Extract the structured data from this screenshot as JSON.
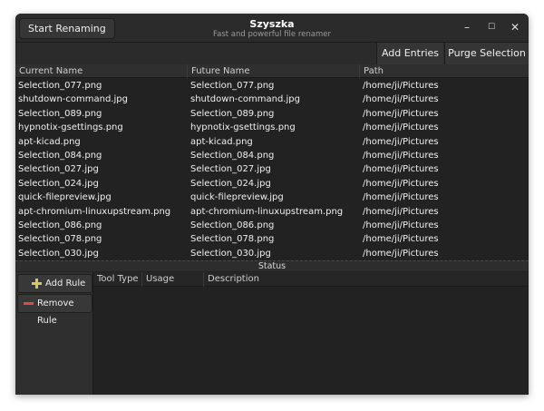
{
  "window": {
    "title": "Szyszka",
    "subtitle": "Fast and powerful file renamer",
    "start_button": "Start Renaming",
    "minimize_glyph": "–",
    "maximize_glyph": "☐",
    "close_glyph": "✕"
  },
  "toolbar": {
    "add_entries": "Add Entries",
    "purge_selection": "Purge Selection"
  },
  "table": {
    "columns": [
      "Current Name",
      "Future Name",
      "Path"
    ],
    "rows": [
      [
        "Selection_077.png",
        "Selection_077.png",
        "/home/ji/Pictures"
      ],
      [
        "shutdown-command.jpg",
        "shutdown-command.jpg",
        "/home/ji/Pictures"
      ],
      [
        "Selection_089.png",
        "Selection_089.png",
        "/home/ji/Pictures"
      ],
      [
        "hypnotix-gsettings.png",
        "hypnotix-gsettings.png",
        "/home/ji/Pictures"
      ],
      [
        "apt-kicad.png",
        "apt-kicad.png",
        "/home/ji/Pictures"
      ],
      [
        "Selection_084.png",
        "Selection_084.png",
        "/home/ji/Pictures"
      ],
      [
        "Selection_027.jpg",
        "Selection_027.jpg",
        "/home/ji/Pictures"
      ],
      [
        "Selection_024.jpg",
        "Selection_024.jpg",
        "/home/ji/Pictures"
      ],
      [
        "quick-filepreview.jpg",
        "quick-filepreview.jpg",
        "/home/ji/Pictures"
      ],
      [
        "apt-chromium-linuxupstream.png",
        "apt-chromium-linuxupstream.png",
        "/home/ji/Pictures"
      ],
      [
        "Selection_086.png",
        "Selection_086.png",
        "/home/ji/Pictures"
      ],
      [
        "Selection_078.png",
        "Selection_078.png",
        "/home/ji/Pictures"
      ],
      [
        "Selection_030.jpg",
        "Selection_030.jpg",
        "/home/ji/Pictures"
      ]
    ]
  },
  "status": {
    "label": "Status"
  },
  "rules": {
    "add_rule": "Add Rule",
    "remove_rule": "Remove Rule",
    "columns": [
      "Tool Type",
      "Usage Name",
      "Description"
    ]
  }
}
